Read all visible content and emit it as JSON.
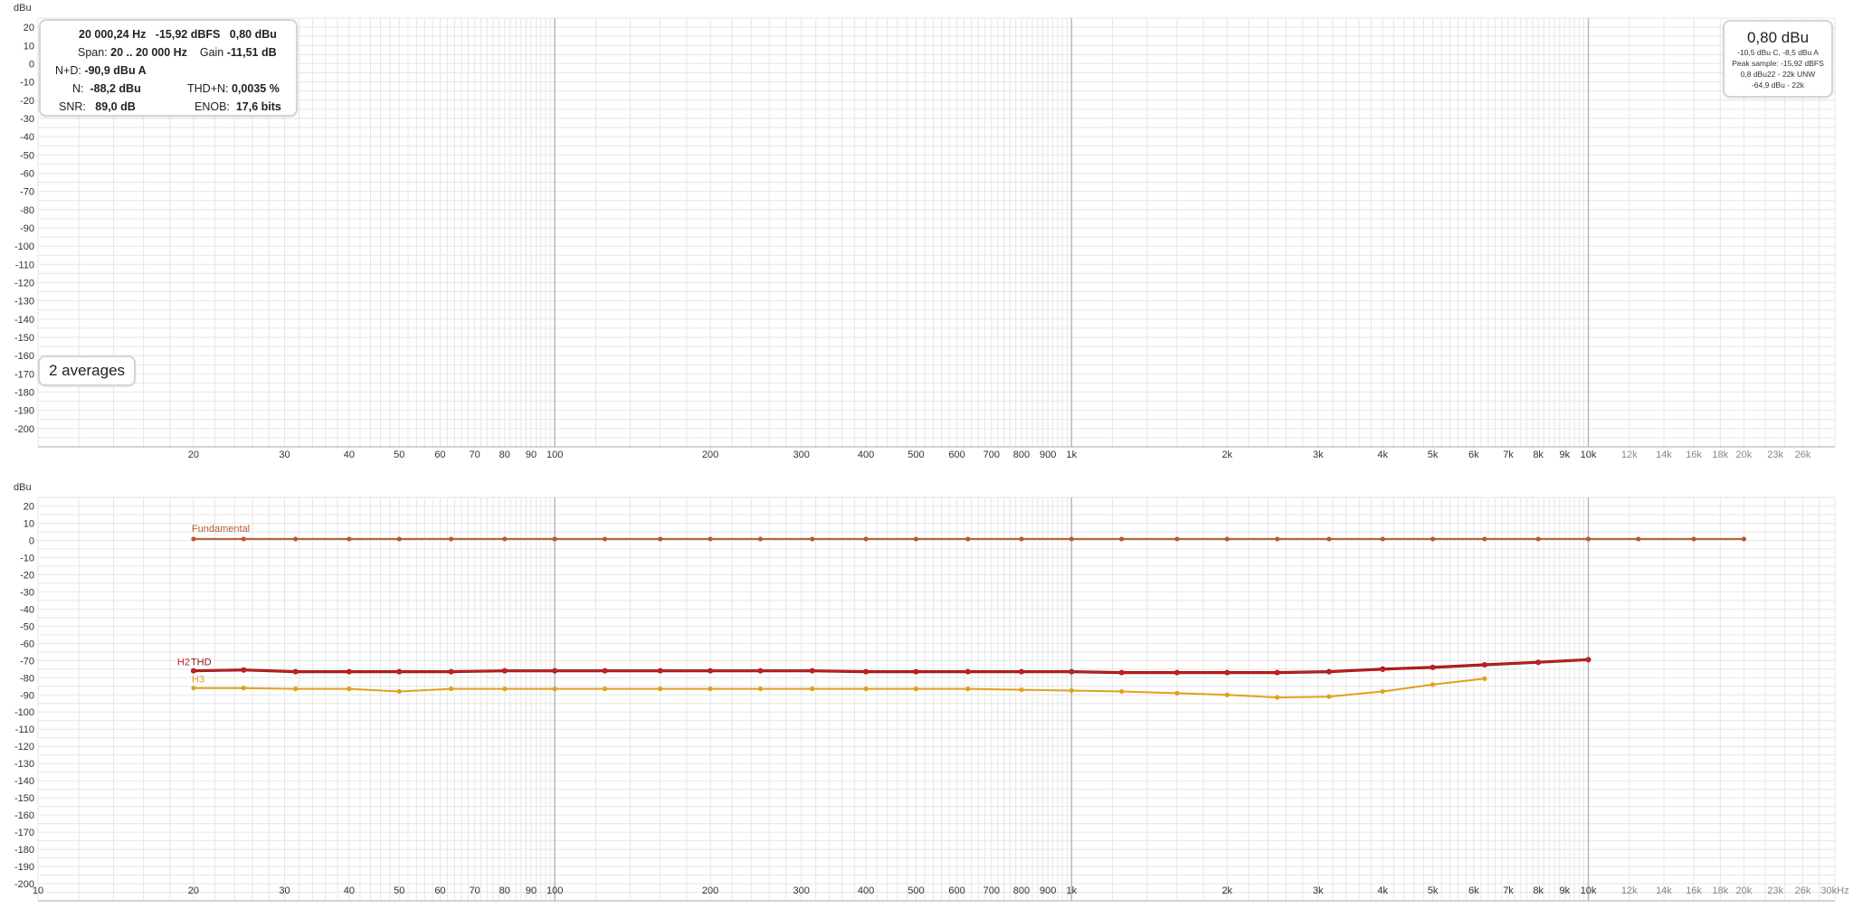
{
  "top_readout": {
    "freq": "20 000,24 Hz",
    "dbfs": "-15,92 dBFS",
    "dbu": "0,80 dBu",
    "span_label": "Span:",
    "span": "20 .. 20 000 Hz",
    "gain_label": "Gain",
    "gain": "-11,51 dB",
    "nd_label": "N+D:",
    "nd": "-90,9 dBu A",
    "n_label": "N:",
    "n": "-88,2 dBu",
    "thdn_label": "THD+N:",
    "thdn": "0,0035 %",
    "snr_label": "SNR:",
    "snr": "89,0 dB",
    "enob_label": "ENOB:",
    "enob": "17,6 bits"
  },
  "averages_label": "2 averages",
  "level_box": {
    "main": "0,80 dBu",
    "line1": "-10,5 dBu C, -8,5 dBu A",
    "line2": "Peak sample: -15,92 dBFS",
    "line3": "0,8 dBu22 - 22k UNW",
    "line4": "-64,9 dBu - 22k"
  },
  "colors": {
    "grid_minor": "#e6e6e6",
    "grid_major": "#b8b8b8",
    "fundamental": "#b85a2c",
    "thd": "#8b1a1a",
    "h2": "#c81e1e",
    "h3": "#e0a020"
  },
  "chart_data": [
    {
      "type": "line",
      "title": "",
      "ylabel": "dBu",
      "xlabel": "",
      "x_scale": "log",
      "xlim": [
        10,
        30000
      ],
      "ylim": [
        -210,
        25
      ],
      "x_tick_labels": [
        "20",
        "30",
        "40",
        "50",
        "60",
        "70",
        "80",
        "90",
        "100",
        "200",
        "300",
        "400",
        "500",
        "600",
        "700",
        "800",
        "900",
        "1k",
        "2k",
        "3k",
        "4k",
        "5k",
        "6k",
        "7k",
        "8k",
        "9k",
        "10k",
        "12k",
        "14k",
        "16k",
        "18k",
        "20k",
        "23k",
        "26k"
      ],
      "y_tick_labels": [
        "20",
        "10",
        "0",
        "-10",
        "-20",
        "-30",
        "-40",
        "-50",
        "-60",
        "-70",
        "-80",
        "-90",
        "-100",
        "-110",
        "-120",
        "-130",
        "-140",
        "-150",
        "-160",
        "-170",
        "-180",
        "-190",
        "-200"
      ],
      "series": []
    },
    {
      "type": "line",
      "title": "",
      "ylabel": "dBu",
      "xlabel": "",
      "x_scale": "log",
      "x_unit": "Hz",
      "xlim": [
        10,
        30000
      ],
      "ylim": [
        -210,
        25
      ],
      "x_tick_labels": [
        "10",
        "20",
        "30",
        "40",
        "50",
        "60",
        "70",
        "80",
        "90",
        "100",
        "200",
        "300",
        "400",
        "500",
        "600",
        "700",
        "800",
        "900",
        "1k",
        "2k",
        "3k",
        "4k",
        "5k",
        "6k",
        "7k",
        "8k",
        "9k",
        "10k",
        "12k",
        "14k",
        "16k",
        "18k",
        "20k",
        "23k",
        "26k",
        "30kHz"
      ],
      "y_tick_labels": [
        "20",
        "10",
        "0",
        "-10",
        "-20",
        "-30",
        "-40",
        "-50",
        "-60",
        "-70",
        "-80",
        "-90",
        "-100",
        "-110",
        "-120",
        "-130",
        "-140",
        "-150",
        "-160",
        "-170",
        "-180",
        "-190",
        "-200"
      ],
      "series": [
        {
          "name": "Fundamental",
          "x": [
            20,
            25,
            31.5,
            40,
            50,
            63,
            80,
            100,
            125,
            160,
            200,
            250,
            315,
            400,
            500,
            630,
            800,
            1000,
            1250,
            1600,
            2000,
            2500,
            3150,
            4000,
            5000,
            6300,
            8000,
            10000,
            12500,
            16000,
            20000
          ],
          "y": [
            0.8,
            0.8,
            0.8,
            0.8,
            0.8,
            0.8,
            0.8,
            0.8,
            0.8,
            0.8,
            0.8,
            0.8,
            0.8,
            0.8,
            0.8,
            0.8,
            0.8,
            0.8,
            0.8,
            0.8,
            0.8,
            0.8,
            0.8,
            0.8,
            0.8,
            0.8,
            0.8,
            0.8,
            0.8,
            0.8,
            0.8
          ]
        },
        {
          "name": "THD",
          "x": [
            20,
            25,
            31.5,
            40,
            50,
            63,
            80,
            100,
            125,
            160,
            200,
            250,
            315,
            400,
            500,
            630,
            800,
            1000,
            1250,
            1600,
            2000,
            2500,
            3150,
            4000,
            5000,
            6300,
            8000,
            10000
          ],
          "y": [
            -76,
            -75.5,
            -76.5,
            -76.5,
            -76.5,
            -76.5,
            -76,
            -76,
            -76,
            -76,
            -76,
            -76,
            -76,
            -76.5,
            -76.5,
            -76.5,
            -76.5,
            -76.5,
            -77,
            -77,
            -77,
            -77,
            -76.5,
            -75,
            -74,
            -72.5,
            -71,
            -69.5
          ]
        },
        {
          "name": "H2",
          "x": [
            20,
            25,
            31.5,
            40,
            50,
            63,
            80,
            100,
            125,
            160,
            200,
            250,
            315,
            400,
            500,
            630,
            800,
            1000,
            1250,
            1600,
            2000,
            2500,
            3150,
            4000,
            5000,
            6300,
            8000,
            10000
          ],
          "y": [
            -76,
            -75.5,
            -76.5,
            -76.5,
            -76.5,
            -76.5,
            -76,
            -76,
            -76,
            -76,
            -76,
            -76,
            -76,
            -76.5,
            -76.5,
            -76.5,
            -76.5,
            -76.5,
            -77,
            -77,
            -77,
            -77,
            -76.5,
            -75.5,
            -74,
            -72.5,
            -71,
            -69.5
          ]
        },
        {
          "name": "H3",
          "x": [
            20,
            25,
            31.5,
            40,
            50,
            63,
            80,
            100,
            125,
            160,
            200,
            250,
            315,
            400,
            500,
            630,
            800,
            1000,
            1250,
            1600,
            2000,
            2500,
            3150,
            4000,
            5000,
            6300
          ],
          "y": [
            -86,
            -86,
            -86.5,
            -86.5,
            -88,
            -86.5,
            -86.5,
            -86.5,
            -86.5,
            -86.5,
            -86.5,
            -86.5,
            -86.5,
            -86.5,
            -86.5,
            -86.5,
            -87,
            -87.5,
            -88,
            -89,
            -90,
            -91.5,
            -91,
            -88,
            -84,
            -80.5
          ]
        }
      ]
    }
  ]
}
